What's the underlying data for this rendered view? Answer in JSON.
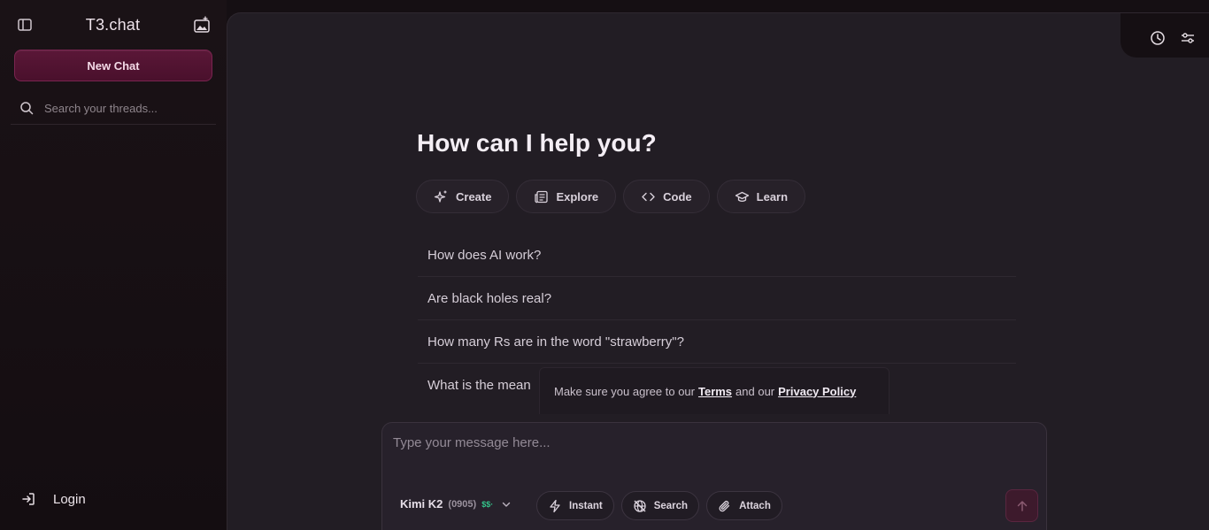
{
  "sidebar": {
    "brand": "T3.chat",
    "new_chat_label": "New Chat",
    "search_placeholder": "Search your threads...",
    "login_label": "Login"
  },
  "main": {
    "heading": "How can I help you?",
    "chips": [
      {
        "label": "Create",
        "icon": "sparkles-icon"
      },
      {
        "label": "Explore",
        "icon": "newspaper-icon"
      },
      {
        "label": "Code",
        "icon": "code-icon"
      },
      {
        "label": "Learn",
        "icon": "graduation-cap-icon"
      }
    ],
    "suggestions": [
      "How does AI work?",
      "Are black holes real?",
      "How many Rs are in the word \"strawberry\"?",
      "What is the mean"
    ],
    "notice": {
      "prefix": "Make sure you agree to our",
      "terms": "Terms",
      "middle": "and our",
      "privacy": "Privacy Policy"
    }
  },
  "composer": {
    "placeholder": "Type your message here...",
    "model_name": "Kimi K2",
    "model_version": "(0905)",
    "model_cost": "$$·",
    "tools": [
      {
        "label": "Instant",
        "icon": "lightning-icon"
      },
      {
        "label": "Search",
        "icon": "globe-off-icon"
      },
      {
        "label": "Attach",
        "icon": "paperclip-icon"
      }
    ]
  },
  "colors": {
    "accent": "#5a1737",
    "cost_green": "#34c48a",
    "background": "#150f13",
    "panel": "#221d24"
  }
}
